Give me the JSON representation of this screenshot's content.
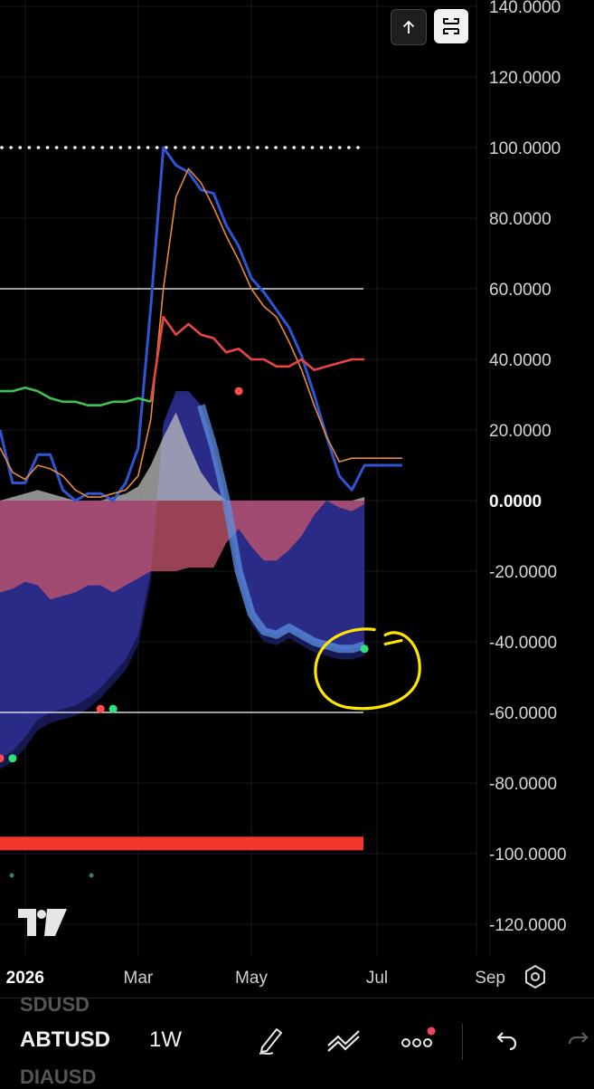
{
  "chart_data": {
    "type": "line",
    "ylim": [
      -128,
      142
    ],
    "y_ticks": [
      "140.0000",
      "120.0000",
      "100.0000",
      "80.0000",
      "60.0000",
      "40.0000",
      "20.0000",
      "0.0000",
      "-20.0000",
      "-40.0000",
      "-60.0000",
      "-80.0000",
      "-100.0000",
      "-120.0000"
    ],
    "y_tick_values": [
      140,
      120,
      100,
      80,
      60,
      40,
      20,
      0,
      -20,
      -40,
      -60,
      -80,
      -100,
      -120
    ],
    "x_ticks": [
      "2026",
      "Mar",
      "May",
      "Jul",
      "Sep"
    ],
    "x_tick_index": [
      2,
      11,
      20,
      30,
      39
    ],
    "grid": true,
    "reference_lines": [
      {
        "value": 100,
        "style": "dotted",
        "color": "#ffffff"
      },
      {
        "value": 60,
        "style": "solid",
        "color": "#ffffff"
      },
      {
        "value": -60,
        "style": "solid",
        "color": "#ffffff"
      }
    ],
    "colors": {
      "blue_line": "#2f55d4",
      "orange_line": "#e8893a",
      "red_line": "#e84545",
      "green_line": "#3fc24f",
      "gray_area": "#bdbdbd",
      "pink_area": "#c4556b",
      "navy_area": "#2b2e8c",
      "light_blue_band": "#5b8fe0",
      "red_bar": "#f2362c",
      "dot_red": "#ff4d4d",
      "dot_green": "#2ee27a",
      "annotation": "#ffe600"
    },
    "series": [
      {
        "key": "blue_line",
        "x": [
          0,
          1,
          2,
          3,
          4,
          5,
          6,
          7,
          8,
          9,
          10,
          11,
          12,
          13,
          14,
          15,
          16,
          17,
          18,
          19,
          20,
          21,
          22,
          23,
          24,
          25,
          26,
          27,
          28,
          29,
          30,
          31,
          32
        ],
        "values": [
          20,
          5,
          5,
          13,
          13,
          3,
          0,
          2,
          2,
          0,
          5,
          15,
          55,
          100,
          95,
          93,
          88,
          87,
          78,
          72,
          63,
          59,
          54,
          49,
          41,
          30,
          18,
          7,
          3,
          10,
          10,
          10,
          10
        ]
      },
      {
        "key": "orange_line",
        "x": [
          0,
          1,
          2,
          3,
          4,
          5,
          6,
          7,
          8,
          9,
          10,
          11,
          12,
          13,
          14,
          15,
          16,
          17,
          18,
          19,
          20,
          21,
          22,
          23,
          24,
          25,
          26,
          27,
          28,
          29,
          30,
          31,
          32
        ],
        "values": [
          15,
          8,
          6,
          10,
          9,
          7,
          3,
          1,
          1,
          2,
          3,
          7,
          23,
          60,
          86,
          94,
          90,
          83,
          75,
          68,
          60,
          55,
          52,
          45,
          37,
          27,
          18,
          11,
          12,
          12,
          12,
          12,
          12
        ]
      },
      {
        "key": "red_line",
        "x": [
          12,
          13,
          14,
          15,
          16,
          17,
          18,
          19,
          20,
          21,
          22,
          23,
          24,
          25,
          26,
          27,
          28,
          29
        ],
        "values": [
          28,
          52,
          47,
          50,
          47,
          46,
          42,
          43,
          40,
          40,
          38,
          38,
          40,
          37,
          38,
          39,
          40,
          40
        ]
      },
      {
        "key": "green_line",
        "x": [
          0,
          1,
          2,
          3,
          4,
          5,
          6,
          7,
          8,
          9,
          10,
          11,
          12
        ],
        "values": [
          31,
          31,
          32,
          31,
          29,
          28,
          28,
          27,
          27,
          28,
          28,
          29,
          28
        ]
      }
    ],
    "areas": [
      {
        "key": "gray_area",
        "x": [
          0,
          1,
          2,
          3,
          4,
          5,
          6,
          7,
          8,
          9,
          10,
          11,
          12,
          13,
          14,
          15,
          16,
          17,
          18,
          19,
          20,
          21,
          22,
          23,
          24,
          25,
          26,
          27,
          28,
          29
        ],
        "values": [
          0,
          1,
          2,
          3,
          2,
          1,
          0,
          0,
          0,
          1,
          2,
          4,
          10,
          18,
          25,
          16,
          8,
          3,
          0,
          0,
          0,
          0,
          0,
          0,
          0,
          0,
          0,
          0,
          0,
          1
        ]
      },
      {
        "key": "pink_area",
        "x": [
          0,
          1,
          2,
          3,
          4,
          5,
          6,
          7,
          8,
          9,
          10,
          11,
          12,
          13,
          14,
          15,
          16,
          17,
          18,
          19,
          20,
          21,
          22,
          23,
          24,
          25,
          26,
          27,
          28,
          29
        ],
        "values": [
          -26,
          -25,
          -23,
          -24,
          -28,
          -27,
          -26,
          -24,
          -24,
          -26,
          -24,
          -22,
          -20,
          -20,
          -20,
          -19,
          -19,
          -19,
          -12,
          -8,
          -13,
          -17,
          -17,
          -14,
          -10,
          -4,
          0,
          -2,
          -3,
          -1
        ]
      },
      {
        "key": "navy_area",
        "x": [
          0,
          1,
          2,
          3,
          4,
          5,
          6,
          7,
          8,
          9,
          10,
          11,
          12,
          13,
          14,
          15,
          16,
          17,
          18,
          19,
          20,
          21,
          22,
          23,
          24,
          25,
          26,
          27,
          28,
          29
        ],
        "values": [
          -73,
          -71,
          -67,
          -62,
          -60,
          -59,
          -58,
          -56,
          -53,
          -49,
          -45,
          -38,
          -20,
          22,
          31,
          31,
          27,
          15,
          0,
          -20,
          -32,
          -37,
          -38,
          -36,
          -38,
          -40,
          -41,
          -42,
          -42,
          -41
        ]
      }
    ],
    "markers": [
      {
        "x": 0,
        "value": -73,
        "color": "dot_red"
      },
      {
        "x": 1,
        "value": -73,
        "color": "dot_green"
      },
      {
        "x": 8,
        "value": -59,
        "color": "dot_red"
      },
      {
        "x": 9,
        "value": -59,
        "color": "dot_green"
      },
      {
        "x": 19,
        "value": 31,
        "color": "dot_red"
      },
      {
        "x": 29,
        "value": -42,
        "color": "dot_green"
      }
    ],
    "bottom_bar_value": -97,
    "annotation": {
      "type": "hand-drawn circle",
      "x": 29,
      "value": -45
    }
  },
  "toolbar": {
    "symbol": "ABTUSD",
    "interval": "1W",
    "ghost_top": "SDUSD",
    "ghost_bottom": "DIAUSD",
    "icons": [
      "pen-icon",
      "lines-icon",
      "more-icon",
      "undo-icon",
      "redo-icon"
    ]
  },
  "top_buttons": [
    "arrow-up-icon",
    "fit-screen-icon"
  ],
  "logo": "tradingview-logo"
}
